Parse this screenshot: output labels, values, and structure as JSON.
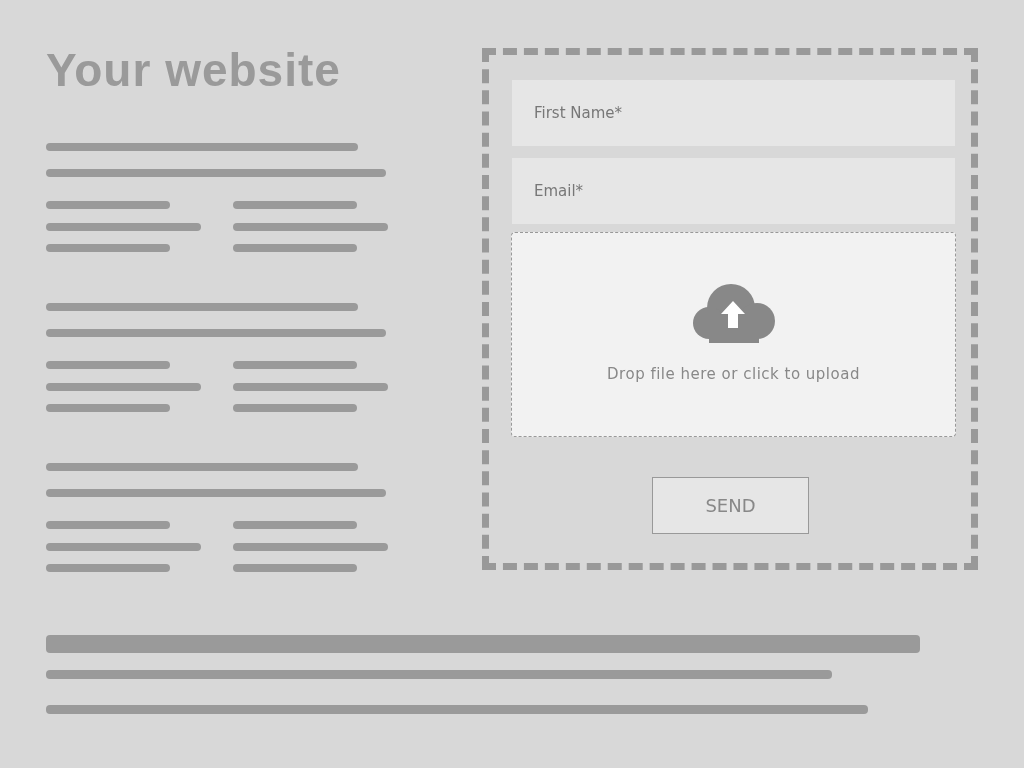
{
  "title": "Your website",
  "form": {
    "fields": [
      {
        "placeholder": "First Name*"
      },
      {
        "placeholder": "Email*"
      }
    ],
    "upload": {
      "text": "Drop file here or click to upload"
    },
    "button": "SEND"
  }
}
